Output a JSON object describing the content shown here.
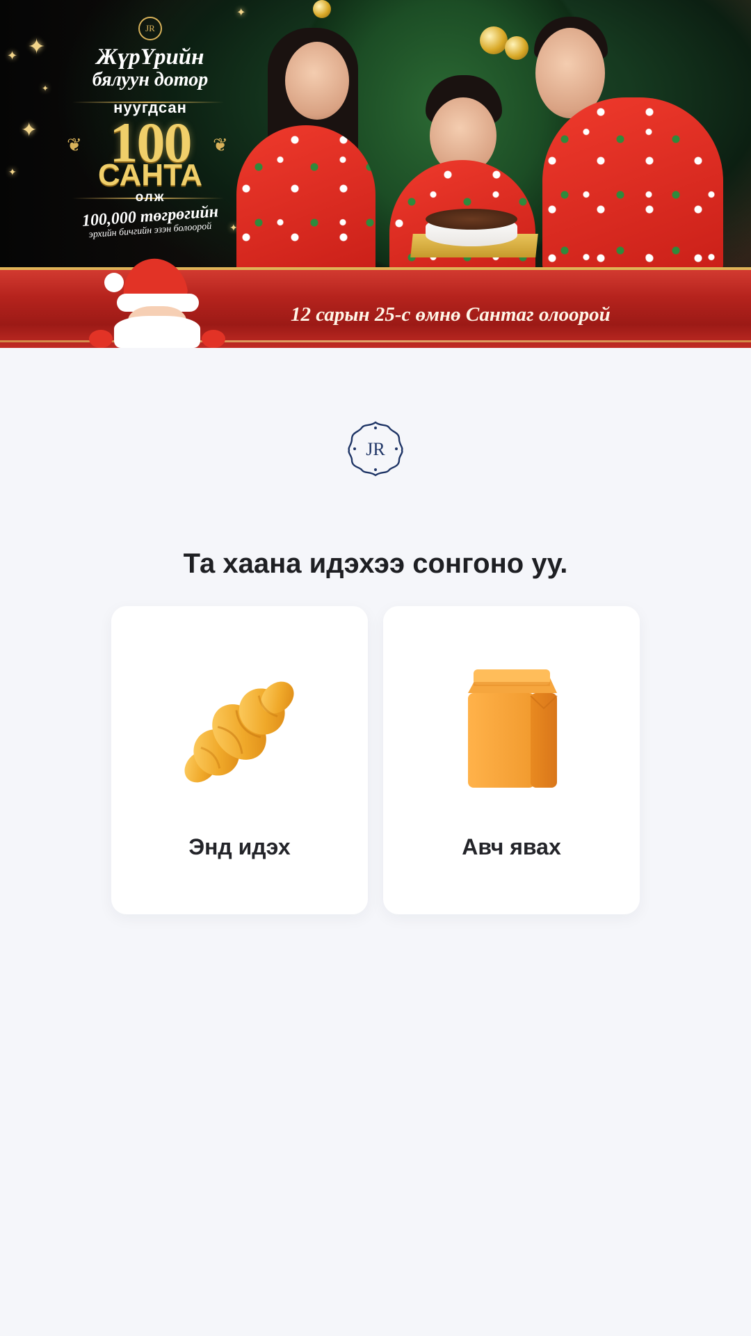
{
  "promo_banner": {
    "brand_mark": "JR",
    "title_line1": "ЖүрҮрийн",
    "title_line2": "бялуун дотор",
    "hidden_label": "нуугдсан",
    "count": "100",
    "santa_word": "САНТА",
    "find_word": "олж",
    "amount": "100,000 төгрөгийн",
    "voucher": "эрхийн бичгийн эзэн болоорой",
    "deadline": "12 сарын 25-с өмнө Сантаг олоорой"
  },
  "brand": {
    "logo_text": "JR"
  },
  "order_type": {
    "title": "Та хаана идэхээ сонгоно уу.",
    "options": [
      {
        "label": "Энд идэх",
        "icon": "croissant-icon"
      },
      {
        "label": "Авч явах",
        "icon": "paper-bag-icon"
      }
    ]
  },
  "colors": {
    "background": "#f5f6fa",
    "card": "#ffffff",
    "brand_navy": "#1f3566",
    "gold": "#d8b25a",
    "ribbon_red": "#b5231d",
    "croissant": "#f0a92a",
    "bag": "#f19a2e"
  }
}
